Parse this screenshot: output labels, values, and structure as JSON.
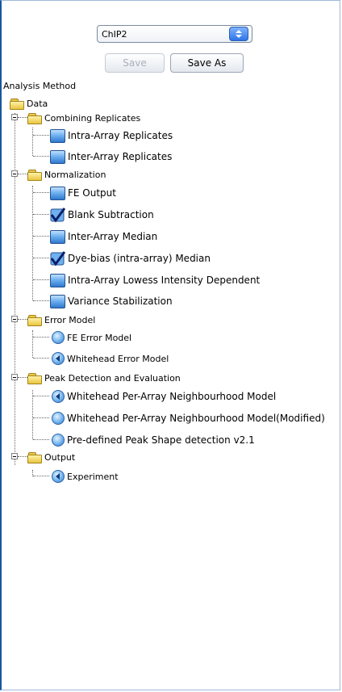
{
  "toolbar": {
    "method_select": "ChIP2",
    "save_label": "Save",
    "save_as_label": "Save As"
  },
  "section_label": "Analysis Method",
  "tree": {
    "root": "Data",
    "combining": {
      "label": "Combining Replicates",
      "items": [
        "Intra-Array Replicates",
        "Inter-Array Replicates"
      ]
    },
    "normalization": {
      "label": "Normalization",
      "items": [
        "FE Output",
        "Blank Subtraction",
        "Inter-Array Median",
        "Dye-bias (intra-array) Median",
        "Intra-Array Lowess Intensity Dependent",
        "Variance Stabilization"
      ]
    },
    "error_model": {
      "label": "Error Model",
      "items": [
        "FE Error Model",
        "Whitehead Error Model"
      ]
    },
    "peak": {
      "label": "Peak Detection and Evaluation",
      "items": [
        "Whitehead Per-Array Neighbourhood Model",
        "Whitehead Per-Array Neighbourhood Model(Modified)",
        "Pre-defined Peak Shape detection v2.1"
      ]
    },
    "output": {
      "label": "Output",
      "items": [
        "Experiment"
      ]
    }
  },
  "colors": {
    "accent": "#2f79cf",
    "folder": "#e9c640",
    "check": "#0a1f6b"
  }
}
